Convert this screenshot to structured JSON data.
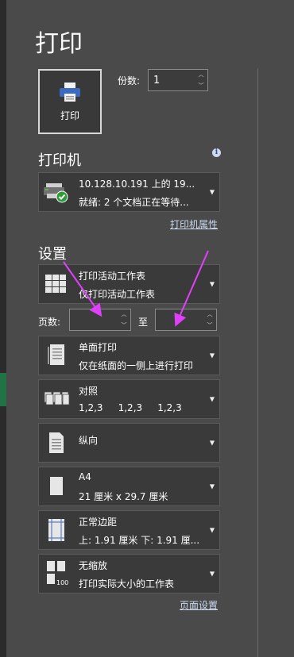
{
  "title": "打印",
  "print_button": {
    "label": "打印",
    "icon": "printer-icon"
  },
  "copies": {
    "label": "份数:",
    "value": "1"
  },
  "printer_section": {
    "title": "打印机",
    "printer": {
      "name": "10.128.10.191 上的 19...",
      "status": "就绪: 2 个文档正在等待..."
    },
    "properties_link": "打印机属性"
  },
  "settings_section": {
    "title": "设置",
    "what_to_print": {
      "line1": "打印活动工作表",
      "line2": "仅打印活动工作表"
    },
    "pages": {
      "label": "页数:",
      "to_label": "至",
      "from_value": "",
      "to_value": ""
    },
    "sides": {
      "line1": "单面打印",
      "line2": "仅在纸面的一侧上进行打印"
    },
    "collation": {
      "line1": "对照",
      "line2": "1,2,3     1,2,3     1,2,3"
    },
    "orientation": {
      "line1": "纵向"
    },
    "paper": {
      "line1": "A4",
      "line2": "21 厘米 x 29.7 厘米"
    },
    "margins": {
      "line1": "正常边距",
      "line2": "上: 1.91 厘米 下: 1.91 厘..."
    },
    "scaling": {
      "line1": "无缩放",
      "line2": "打印实际大小的工作表"
    },
    "page_setup_link": "页面设置"
  },
  "colors": {
    "background": "#4a4a4a",
    "annotation_arrow": "#e040fb",
    "excel_green": "#217346"
  }
}
